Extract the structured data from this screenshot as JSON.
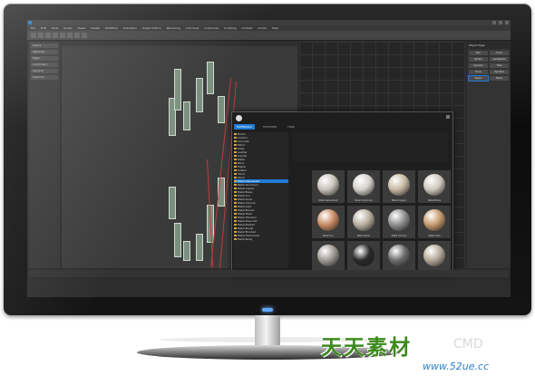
{
  "watermark": {
    "cn": "天天素材",
    "url": "www.52ue.cc",
    "faint": "CMD"
  },
  "app": {
    "menus": [
      "File",
      "Edit",
      "Tools",
      "Group",
      "Views",
      "Create",
      "Modifiers",
      "Animation",
      "Graph Editors",
      "Rendering",
      "Civil View",
      "Customize",
      "Scripting",
      "Content",
      "Arnold",
      "Help"
    ],
    "command_panel": {
      "title": "Object Type",
      "buttons": [
        "Box",
        "Cone",
        "Sphere",
        "GeoSphere",
        "Cylinder",
        "Tube",
        "Torus",
        "Pyramid",
        "Teapot",
        "Plane"
      ]
    },
    "left_panel": [
      "Scene",
      "Materials",
      "Maps",
      "Controllers",
      "General",
      "Scanline"
    ]
  },
  "browser": {
    "tabs": [
      "MATERIALS",
      "TEXTURES",
      "HDRI"
    ],
    "folders": [
      "Bricks",
      "Ceramic",
      "Concrete",
      "Fabric",
      "Glass",
      "Leather",
      "Liquids",
      "Metal",
      "Paint",
      "Plastic",
      "Rubber",
      "Stone",
      "Wood",
      "Metal Galvanized",
      "Metal Aluminum",
      "Metal Copper",
      "Metal Brass",
      "Metal Iron",
      "Metal Silver",
      "Metal Chrome",
      "Metal Gold",
      "Metal Bronze",
      "Metal Steel",
      "Metal Titanium",
      "Metal Steel Old",
      "Metal Painted",
      "Metal Rough",
      "Metal Brushed",
      "Metal Hammered",
      "Metal Rusty"
    ],
    "selected_folder_index": 13,
    "swatches": [
      {
        "label": "Metal Galvanized",
        "color": "#c9c3b8"
      },
      {
        "label": "Metal Aluminum",
        "color": "#d4d1cb"
      },
      {
        "label": "Metal Copper",
        "color": "#c7b9a2"
      },
      {
        "label": "Metal Brass",
        "color": "#cfc8bd"
      },
      {
        "label": "Metal Iron",
        "color": "#c98a64"
      },
      {
        "label": "Metal Silver",
        "color": "#b8aea0"
      },
      {
        "label": "Metal Chrome",
        "color": "#8e8e8e"
      },
      {
        "label": "Metal Gold",
        "color": "#c59a6b"
      },
      {
        "label": "Metal Bronze",
        "color": "#9f9a93"
      },
      {
        "label": "Metal Steel",
        "color": "#2a2a2a"
      },
      {
        "label": "Metal Titanium",
        "color": "#6d6d6d"
      },
      {
        "label": "Metal Steel Old",
        "color": "#b7a99a"
      }
    ]
  }
}
